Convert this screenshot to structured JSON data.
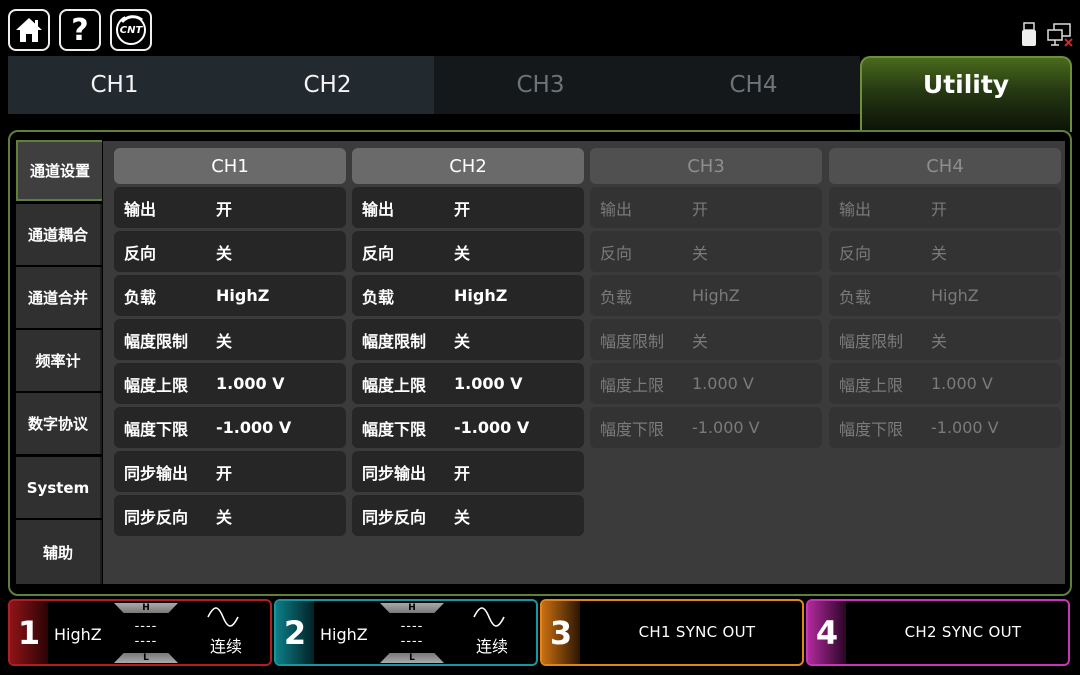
{
  "topbar": {
    "help_glyph": "?",
    "logo_text": "CNT",
    "icons": [
      "home-icon",
      "help-icon",
      "cnt-logo-icon",
      "usb-icon",
      "network-disconnected-icon"
    ]
  },
  "tabs": [
    {
      "label": "CH1",
      "state": "enabled"
    },
    {
      "label": "CH2",
      "state": "enabled"
    },
    {
      "label": "CH3",
      "state": "disabled"
    },
    {
      "label": "CH4",
      "state": "disabled"
    },
    {
      "label": "Utility",
      "state": "active"
    }
  ],
  "sidebar": {
    "items": [
      {
        "label": "通道设置",
        "active": true
      },
      {
        "label": "通道耦合"
      },
      {
        "label": "通道合并"
      },
      {
        "label": "频率计"
      },
      {
        "label": "数字协议"
      },
      {
        "label": "System"
      },
      {
        "label": "辅助"
      }
    ]
  },
  "channels": [
    {
      "name": "CH1",
      "enabled": true,
      "rows": [
        {
          "label": "输出",
          "value": "开"
        },
        {
          "label": "反向",
          "value": "关"
        },
        {
          "label": "负载",
          "value": "HighZ"
        },
        {
          "label": "幅度限制",
          "value": "关"
        },
        {
          "label": "幅度上限",
          "value": "1.000 V"
        },
        {
          "label": "幅度下限",
          "value": "-1.000 V"
        },
        {
          "label": "同步输出",
          "value": "开"
        },
        {
          "label": "同步反向",
          "value": "关"
        }
      ]
    },
    {
      "name": "CH2",
      "enabled": true,
      "rows": [
        {
          "label": "输出",
          "value": "开"
        },
        {
          "label": "反向",
          "value": "关"
        },
        {
          "label": "负载",
          "value": "HighZ"
        },
        {
          "label": "幅度限制",
          "value": "关"
        },
        {
          "label": "幅度上限",
          "value": "1.000 V"
        },
        {
          "label": "幅度下限",
          "value": "-1.000 V"
        },
        {
          "label": "同步输出",
          "value": "开"
        },
        {
          "label": "同步反向",
          "value": "关"
        }
      ]
    },
    {
      "name": "CH3",
      "enabled": false,
      "rows": [
        {
          "label": "输出",
          "value": "开"
        },
        {
          "label": "反向",
          "value": "关"
        },
        {
          "label": "负载",
          "value": "HighZ"
        },
        {
          "label": "幅度限制",
          "value": "关"
        },
        {
          "label": "幅度上限",
          "value": "1.000 V"
        },
        {
          "label": "幅度下限",
          "value": "-1.000 V"
        }
      ]
    },
    {
      "name": "CH4",
      "enabled": false,
      "rows": [
        {
          "label": "输出",
          "value": "开"
        },
        {
          "label": "反向",
          "value": "关"
        },
        {
          "label": "负载",
          "value": "HighZ"
        },
        {
          "label": "幅度限制",
          "value": "关"
        },
        {
          "label": "幅度上限",
          "value": "1.000 V"
        },
        {
          "label": "幅度下限",
          "value": "-1.000 V"
        }
      ]
    }
  ],
  "bottom": {
    "cards": [
      {
        "num": "1",
        "load": "HighZ",
        "high_cap": "H",
        "low_cap": "L",
        "high": "----",
        "low": "----",
        "wave_icon": "sine-wave-icon",
        "mode": "连续",
        "color": "#d6262b"
      },
      {
        "num": "2",
        "load": "HighZ",
        "high_cap": "H",
        "low_cap": "L",
        "high": "----",
        "low": "----",
        "wave_icon": "sine-wave-icon",
        "mode": "连续",
        "color": "#17b8c2"
      },
      {
        "num": "3",
        "sync": "CH1 SYNC OUT",
        "color": "#f08c1a"
      },
      {
        "num": "4",
        "sync": "CH2 SYNC OUT",
        "color": "#d83fc4"
      }
    ]
  },
  "colors": {
    "accent_green": "#6b8f3a",
    "ch1": "#d6262b",
    "ch2": "#17b8c2",
    "ch3": "#f08c1a",
    "ch4": "#d83fc4"
  }
}
